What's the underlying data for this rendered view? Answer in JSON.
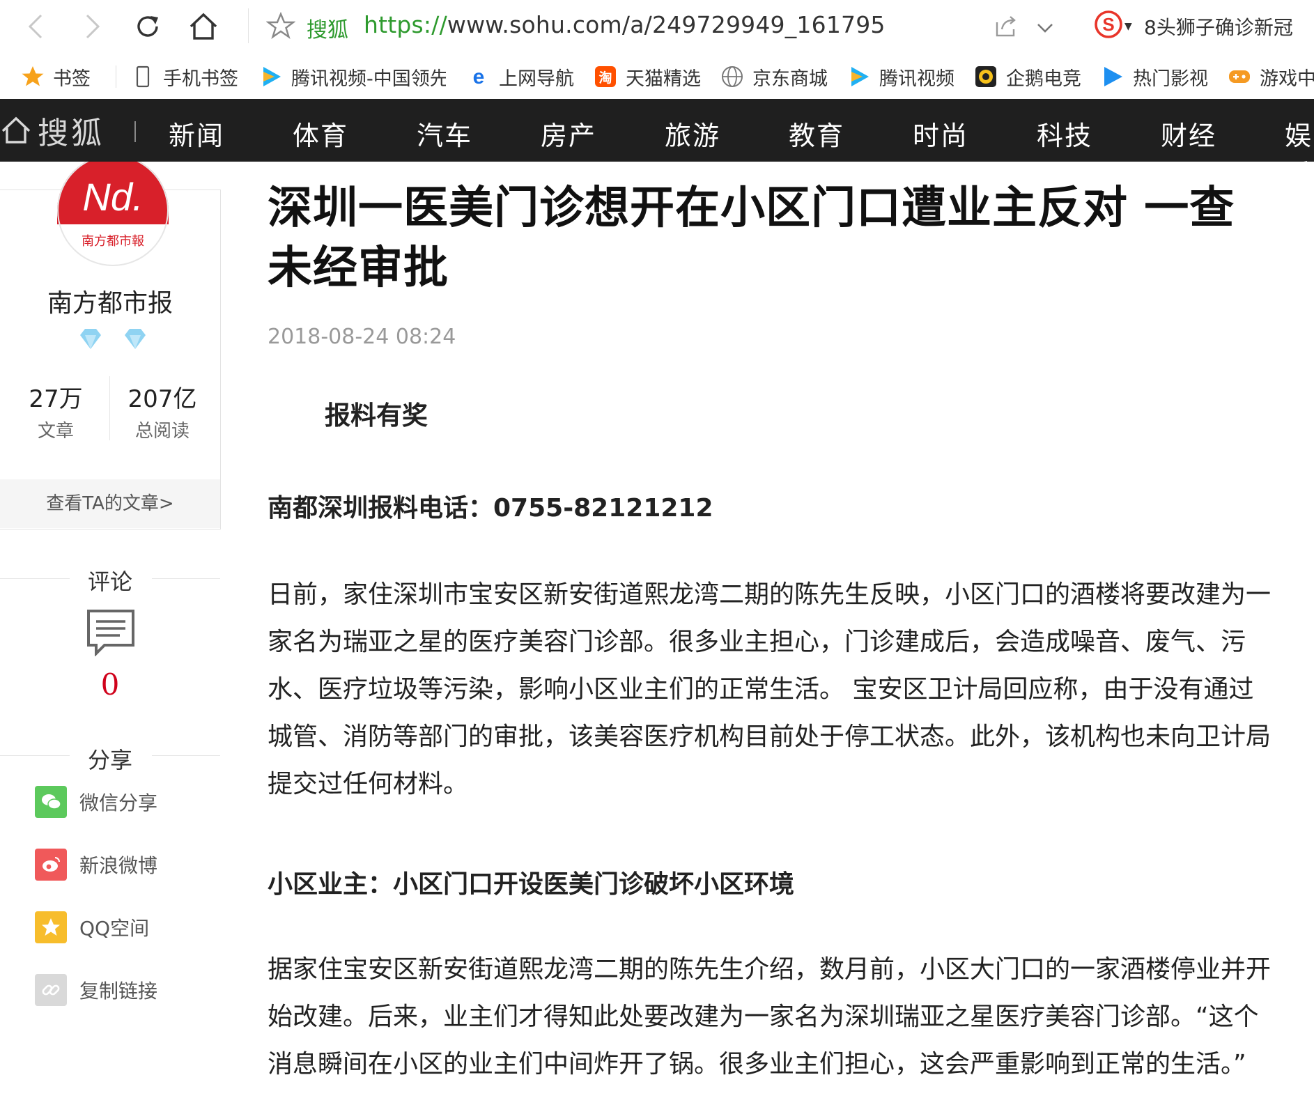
{
  "browser": {
    "site_name": "搜狐",
    "url_proto": "https://",
    "url_rest": "www.sohu.com/a/249729949_161795",
    "hot_search": "8头狮子确诊新冠"
  },
  "bookmarks": [
    {
      "label": "书签",
      "icon": "star-icon"
    },
    {
      "label": "手机书签",
      "icon": "phone-icon"
    },
    {
      "label": "腾讯视频-中国领先",
      "icon": "tencent-video-icon"
    },
    {
      "label": "上网导航",
      "icon": "ie-icon"
    },
    {
      "label": "天猫精选",
      "icon": "tmall-icon"
    },
    {
      "label": "京东商城",
      "icon": "globe-icon"
    },
    {
      "label": "腾讯视频",
      "icon": "tencent-video-icon"
    },
    {
      "label": "企鹅电竞",
      "icon": "penguin-icon"
    },
    {
      "label": "热门影视",
      "icon": "play-icon"
    },
    {
      "label": "游戏中",
      "icon": "game-icon"
    }
  ],
  "sohu_nav": {
    "logo": "搜狐",
    "items": [
      "新闻",
      "体育",
      "汽车",
      "房产",
      "旅游",
      "教育",
      "时尚",
      "科技",
      "财经",
      "娱乐"
    ]
  },
  "author": {
    "logo_text": "Nd.",
    "logo_sub": "南方都市報",
    "name": "南方都市报",
    "articles_num": "27万",
    "articles_label": "文章",
    "reads_num": "207亿",
    "reads_label": "总阅读",
    "view_link": "查看TA的文章>"
  },
  "comments": {
    "title": "评论",
    "count": "0"
  },
  "share": {
    "title": "分享",
    "items": [
      {
        "label": "微信分享",
        "color": "#5cc95c"
      },
      {
        "label": "新浪微博",
        "color": "#f0595a"
      },
      {
        "label": "QQ空间",
        "color": "#f7bd2c"
      },
      {
        "label": "复制链接",
        "color": "#d9d9d9"
      }
    ]
  },
  "article": {
    "title": "深圳一医美门诊想开在小区门口遭业主反对 一查未经审批",
    "date": "2018-08-24 08:24",
    "banner": "报料有奖",
    "hotline": "南都深圳报料电话：0755-82121212",
    "para1": "日前，家住深圳市宝安区新安街道熙龙湾二期的陈先生反映，小区门口的酒楼将要改建为一家名为瑞亚之星的医疗美容门诊部。很多业主担心，门诊建成后，会造成噪音、废气、污水、医疗垃圾等污染，影响小区业主们的正常生活。 宝安区卫计局回应称，由于没有通过城管、消防等部门的审批，该美容医疗机构目前处于停工状态。此外，该机构也未向卫计局提交过任何材料。",
    "subhead": "小区业主：小区门口开设医美门诊破坏小区环境",
    "para2": "据家住宝安区新安街道熙龙湾二期的陈先生介绍，数月前，小区大门口的一家酒楼停业并开始改建。后来，业主们才得知此处要改建为一家名为深圳瑞亚之星医疗美容门诊部。“这个消息瞬间在小区的业主们中间炸开了锅。很多业主们担心，这会严重影响到正常的生活。”"
  }
}
